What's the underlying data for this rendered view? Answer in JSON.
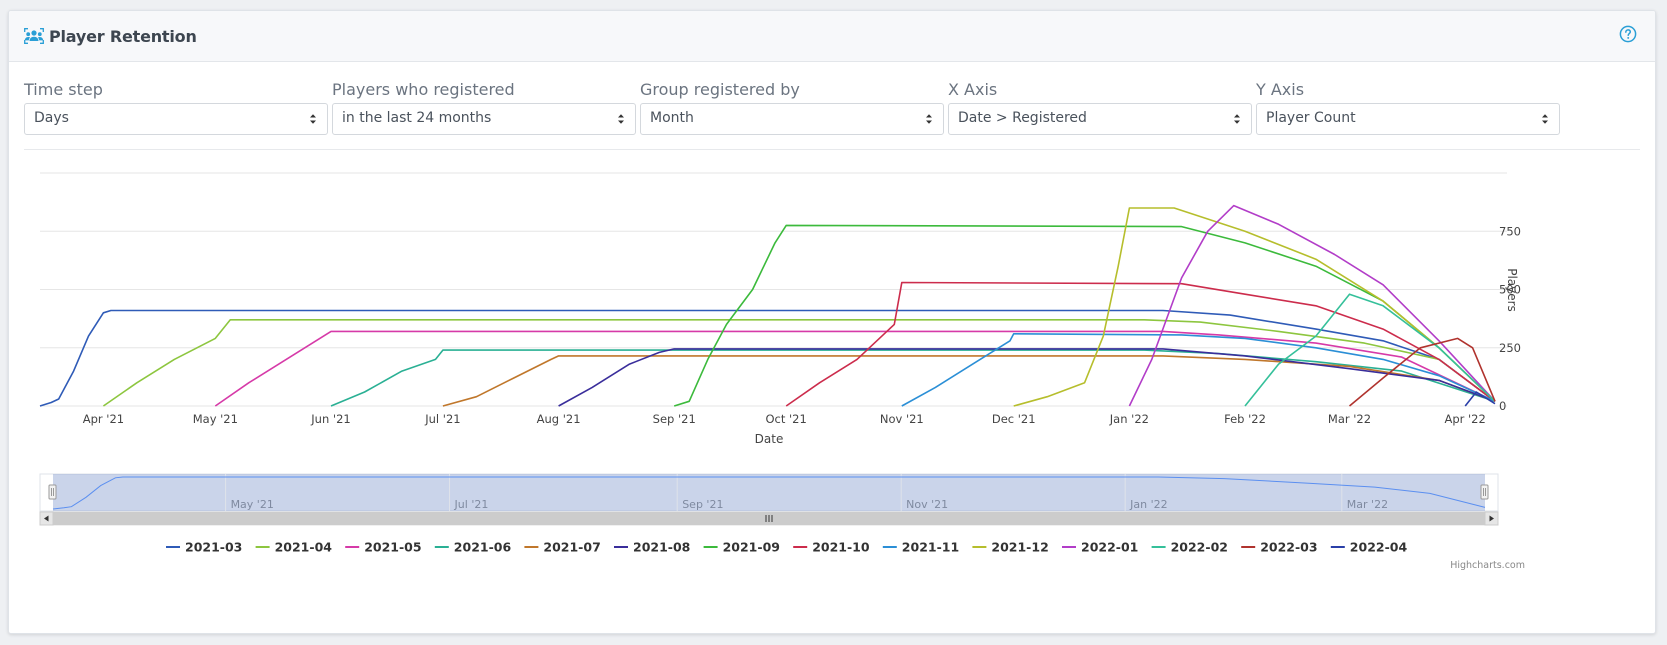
{
  "header": {
    "title": "Player Retention",
    "title_icon": "users-group-icon",
    "help_icon": "question-circle-icon",
    "accent": "#2a9fd6"
  },
  "controls": [
    {
      "label": "Time step",
      "value": "Days"
    },
    {
      "label": "Players who registered",
      "value": "in the last 24 months"
    },
    {
      "label": "Group registered by",
      "value": "Month"
    },
    {
      "label": "X Axis",
      "value": "Date > Registered"
    },
    {
      "label": "Y Axis",
      "value": "Player Count"
    }
  ],
  "chart_data": {
    "type": "line",
    "xlabel": "Date",
    "ylabel": "Players",
    "x_tick_labels": [
      "Apr '21",
      "May '21",
      "Jun '21",
      "Jul '21",
      "Aug '21",
      "Sep '21",
      "Oct '21",
      "Nov '21",
      "Dec '21",
      "Jan '22",
      "Feb '22",
      "Mar '22",
      "Apr '22"
    ],
    "y_tick_labels": [
      "0",
      "250",
      "500",
      "750"
    ],
    "xlim": [
      "2021-03-15",
      "2022-04-09"
    ],
    "ylim": [
      0,
      1000
    ],
    "grid": true,
    "legend_position": "bottom",
    "series": [
      {
        "name": "2021-03",
        "color": "#2f5bb7",
        "points": [
          [
            "2021-03-15",
            0
          ],
          [
            "2021-03-18",
            15
          ],
          [
            "2021-03-20",
            30
          ],
          [
            "2021-03-24",
            150
          ],
          [
            "2021-03-28",
            300
          ],
          [
            "2021-04-01",
            400
          ],
          [
            "2021-04-03",
            410
          ],
          [
            "2022-01-10",
            410
          ],
          [
            "2022-01-28",
            390
          ],
          [
            "2022-02-20",
            330
          ],
          [
            "2022-03-10",
            280
          ],
          [
            "2022-03-25",
            200
          ],
          [
            "2022-04-09",
            20
          ]
        ]
      },
      {
        "name": "2021-04",
        "color": "#8dc63f",
        "points": [
          [
            "2021-04-01",
            0
          ],
          [
            "2021-04-10",
            100
          ],
          [
            "2021-04-20",
            200
          ],
          [
            "2021-05-01",
            290
          ],
          [
            "2021-05-05",
            370
          ],
          [
            "2022-01-05",
            370
          ],
          [
            "2022-01-20",
            360
          ],
          [
            "2022-02-10",
            320
          ],
          [
            "2022-03-05",
            270
          ],
          [
            "2022-03-25",
            200
          ],
          [
            "2022-04-09",
            20
          ]
        ]
      },
      {
        "name": "2021-05",
        "color": "#d63aa8",
        "points": [
          [
            "2021-05-01",
            0
          ],
          [
            "2021-05-10",
            100
          ],
          [
            "2021-05-20",
            200
          ],
          [
            "2021-06-01",
            320
          ],
          [
            "2022-01-10",
            320
          ],
          [
            "2022-01-25",
            305
          ],
          [
            "2022-02-20",
            270
          ],
          [
            "2022-03-15",
            210
          ],
          [
            "2022-04-09",
            20
          ]
        ]
      },
      {
        "name": "2021-06",
        "color": "#2ab094",
        "points": [
          [
            "2021-06-01",
            0
          ],
          [
            "2021-06-10",
            60
          ],
          [
            "2021-06-20",
            150
          ],
          [
            "2021-06-29",
            200
          ],
          [
            "2021-07-01",
            240
          ],
          [
            "2022-01-05",
            240
          ],
          [
            "2022-01-25",
            225
          ],
          [
            "2022-02-20",
            190
          ],
          [
            "2022-03-15",
            150
          ],
          [
            "2022-04-09",
            20
          ]
        ]
      },
      {
        "name": "2021-07",
        "color": "#c0772b",
        "points": [
          [
            "2021-07-01",
            0
          ],
          [
            "2021-07-10",
            40
          ],
          [
            "2021-07-20",
            120
          ],
          [
            "2021-07-30",
            200
          ],
          [
            "2021-08-01",
            215
          ],
          [
            "2022-01-10",
            215
          ],
          [
            "2022-02-01",
            200
          ],
          [
            "2022-03-01",
            170
          ],
          [
            "2022-03-25",
            110
          ],
          [
            "2022-04-09",
            20
          ]
        ]
      },
      {
        "name": "2021-08",
        "color": "#3a2e9b",
        "points": [
          [
            "2021-08-01",
            0
          ],
          [
            "2021-08-10",
            80
          ],
          [
            "2021-08-20",
            180
          ],
          [
            "2021-08-28",
            230
          ],
          [
            "2021-09-01",
            245
          ],
          [
            "2022-01-10",
            245
          ],
          [
            "2022-02-01",
            215
          ],
          [
            "2022-03-01",
            160
          ],
          [
            "2022-03-25",
            110
          ],
          [
            "2022-04-09",
            20
          ]
        ]
      },
      {
        "name": "2021-09",
        "color": "#3cba3c",
        "points": [
          [
            "2021-09-01",
            0
          ],
          [
            "2021-09-05",
            20
          ],
          [
            "2021-09-10",
            200
          ],
          [
            "2021-09-15",
            350
          ],
          [
            "2021-09-22",
            500
          ],
          [
            "2021-09-28",
            700
          ],
          [
            "2021-10-01",
            775
          ],
          [
            "2022-01-15",
            770
          ],
          [
            "2022-02-01",
            700
          ],
          [
            "2022-02-20",
            600
          ],
          [
            "2022-03-10",
            450
          ],
          [
            "2022-03-25",
            250
          ],
          [
            "2022-04-09",
            20
          ]
        ]
      },
      {
        "name": "2021-10",
        "color": "#cc2c4c",
        "points": [
          [
            "2021-10-01",
            0
          ],
          [
            "2021-10-10",
            100
          ],
          [
            "2021-10-20",
            200
          ],
          [
            "2021-10-30",
            350
          ],
          [
            "2021-11-01",
            530
          ],
          [
            "2022-01-15",
            525
          ],
          [
            "2022-02-01",
            480
          ],
          [
            "2022-02-20",
            430
          ],
          [
            "2022-03-10",
            330
          ],
          [
            "2022-03-25",
            200
          ],
          [
            "2022-04-09",
            20
          ]
        ]
      },
      {
        "name": "2021-11",
        "color": "#2b8fd6",
        "points": [
          [
            "2021-11-01",
            0
          ],
          [
            "2021-11-10",
            80
          ],
          [
            "2021-11-20",
            180
          ],
          [
            "2021-11-30",
            280
          ],
          [
            "2021-12-01",
            310
          ],
          [
            "2022-01-15",
            305
          ],
          [
            "2022-02-01",
            290
          ],
          [
            "2022-02-20",
            250
          ],
          [
            "2022-03-10",
            200
          ],
          [
            "2022-03-25",
            130
          ],
          [
            "2022-04-09",
            20
          ]
        ]
      },
      {
        "name": "2021-12",
        "color": "#b6be2c",
        "points": [
          [
            "2021-12-01",
            0
          ],
          [
            "2021-12-10",
            40
          ],
          [
            "2021-12-20",
            100
          ],
          [
            "2021-12-25",
            300
          ],
          [
            "2021-12-29",
            600
          ],
          [
            "2022-01-01",
            850
          ],
          [
            "2022-01-13",
            850
          ],
          [
            "2022-02-01",
            750
          ],
          [
            "2022-02-20",
            630
          ],
          [
            "2022-03-10",
            450
          ],
          [
            "2022-03-25",
            250
          ],
          [
            "2022-04-09",
            20
          ]
        ]
      },
      {
        "name": "2022-01",
        "color": "#b23dc8",
        "points": [
          [
            "2022-01-01",
            0
          ],
          [
            "2022-01-07",
            200
          ],
          [
            "2022-01-15",
            550
          ],
          [
            "2022-01-22",
            750
          ],
          [
            "2022-01-29",
            860
          ],
          [
            "2022-02-10",
            780
          ],
          [
            "2022-02-25",
            650
          ],
          [
            "2022-03-10",
            520
          ],
          [
            "2022-03-25",
            280
          ],
          [
            "2022-04-09",
            20
          ]
        ]
      },
      {
        "name": "2022-02",
        "color": "#35c09a",
        "points": [
          [
            "2022-02-01",
            0
          ],
          [
            "2022-02-10",
            180
          ],
          [
            "2022-02-20",
            300
          ],
          [
            "2022-03-01",
            480
          ],
          [
            "2022-03-10",
            430
          ],
          [
            "2022-03-25",
            250
          ],
          [
            "2022-04-09",
            20
          ]
        ]
      },
      {
        "name": "2022-03",
        "color": "#b0332e",
        "points": [
          [
            "2022-03-01",
            0
          ],
          [
            "2022-03-10",
            120
          ],
          [
            "2022-03-20",
            250
          ],
          [
            "2022-03-30",
            290
          ],
          [
            "2022-04-03",
            250
          ],
          [
            "2022-04-09",
            20
          ]
        ]
      },
      {
        "name": "2022-04",
        "color": "#2a3fa8",
        "points": [
          [
            "2022-04-01",
            0
          ],
          [
            "2022-04-04",
            60
          ],
          [
            "2022-04-09",
            10
          ]
        ]
      }
    ]
  },
  "navigator": {
    "tick_labels": [
      "May '21",
      "Jul '21",
      "Sep '21",
      "Nov '21",
      "Jan '22",
      "Mar '22"
    ],
    "handle_icon": "grip-lines-icon",
    "left_arrow_icon": "arrow-left-icon",
    "right_arrow_icon": "arrow-right-icon"
  },
  "credits": "Highcharts.com"
}
